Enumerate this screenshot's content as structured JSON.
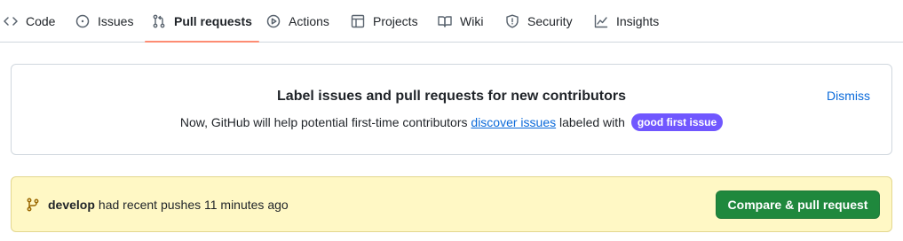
{
  "nav": {
    "tabs": [
      {
        "label": "Code",
        "icon": "code-icon"
      },
      {
        "label": "Issues",
        "icon": "issue-opened-icon"
      },
      {
        "label": "Pull requests",
        "icon": "git-pull-request-icon",
        "selected": true
      },
      {
        "label": "Actions",
        "icon": "play-icon"
      },
      {
        "label": "Projects",
        "icon": "table-icon"
      },
      {
        "label": "Wiki",
        "icon": "book-icon"
      },
      {
        "label": "Security",
        "icon": "shield-icon"
      },
      {
        "label": "Insights",
        "icon": "graph-icon"
      }
    ],
    "selected_underline_color": "#fd8c73"
  },
  "banner": {
    "title": "Label issues and pull requests for new contributors",
    "text_before": "Now, GitHub will help potential first-time contributors",
    "link_text": "discover issues",
    "text_after": "labeled with",
    "label": "good first issue",
    "label_color": "#7057ff",
    "dismiss_label": "Dismiss"
  },
  "recent_push": {
    "branch": "develop",
    "message": "had recent pushes 11 minutes ago",
    "button_label": "Compare & pull request",
    "button_color": "#1f883d",
    "background_color": "#fff8c5"
  }
}
